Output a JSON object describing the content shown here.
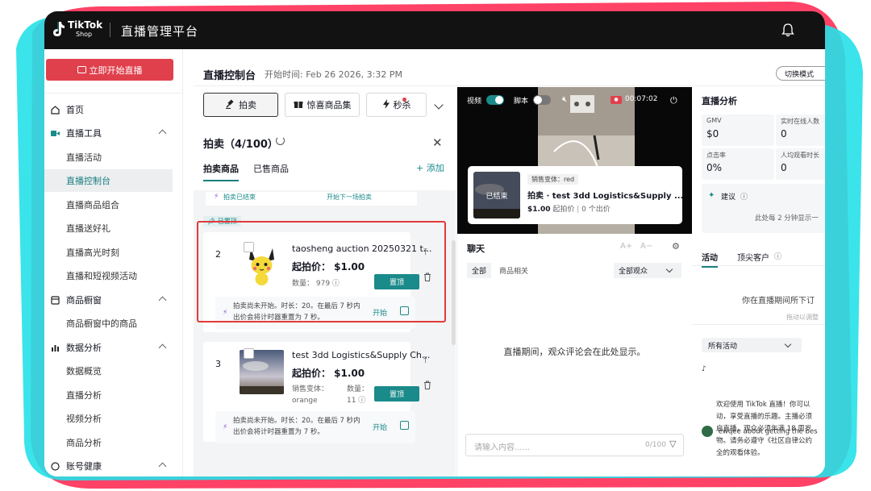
{
  "brand": {
    "logo_text": "TikTok",
    "logo_sub": "Shop",
    "platform_title": "直播管理平台",
    "accent": "#1a8a8a",
    "live_red": "#e0404c"
  },
  "sidebar": {
    "go_live": "立即开始直播",
    "items": [
      {
        "label": "首页",
        "icon": "home-icon",
        "level": 1
      },
      {
        "label": "直播工具",
        "icon": "video-icon",
        "level": 1
      },
      {
        "label": "直播活动",
        "level": 2
      },
      {
        "label": "直播控制台",
        "level": 2,
        "active": true
      },
      {
        "label": "直播商品组合",
        "level": 2
      },
      {
        "label": "直播送好礼",
        "level": 2
      },
      {
        "label": "直播高光时刻",
        "level": 2
      },
      {
        "label": "直播和短视频活动",
        "level": 2
      },
      {
        "label": "商品橱窗",
        "icon": "store-icon",
        "level": 1
      },
      {
        "label": "商品橱窗中的商品",
        "level": 2
      },
      {
        "label": "数据分析",
        "icon": "chart-icon",
        "level": 1
      },
      {
        "label": "数据概览",
        "level": 2
      },
      {
        "label": "直播分析",
        "level": 2
      },
      {
        "label": "视频分析",
        "level": 2
      },
      {
        "label": "商品分析",
        "level": 2
      },
      {
        "label": "账号健康",
        "icon": "health-icon",
        "level": 1
      }
    ]
  },
  "header": {
    "title": "直播控制台",
    "start_time": "开始时间: Feb 26 2026, 3:32 PM",
    "switch_mode": "切换模式"
  },
  "tools": {
    "auction": "拍卖",
    "surprise": "惊喜商品集",
    "flash": "秒杀"
  },
  "auction": {
    "title": "拍卖（4/100）",
    "tab_products": "拍卖商品",
    "tab_sold": "已售商品",
    "add": "添加",
    "prev_ended": "拍卖已结束",
    "prev_next": "开始下一场拍卖",
    "pinned_label": "已置顶",
    "cards": [
      {
        "index": "2",
        "name": "taosheng auction 20250321 t...",
        "price": "起拍价： $1.00",
        "qty": "数量： 979",
        "pin_btn": "置顶",
        "info": "拍卖尚未开始。时长：20。在最后 7 秒内出价会将计时器重置为 7 秒。",
        "start": "开始"
      },
      {
        "index": "3",
        "name": "test 3dd Logistics&Supply Ch...",
        "price": "起拍价： $1.00",
        "variant_label": "销售变体：",
        "variant_value": "orange",
        "qty_label": "数量：",
        "qty_value": "11",
        "pin_btn": "置顶",
        "info": "拍卖尚未开始。时长：20。在最后 7 秒内出价会将计时器重置为 7 秒。",
        "start": "开始"
      }
    ]
  },
  "video": {
    "video_label": "视频",
    "script_label": "脚本",
    "time": "00:07:02",
    "popup": {
      "variant": "销售变体：red",
      "ended": "已结束",
      "name": "拍卖 · test 3dd Logistics&Supply ...",
      "price": "$1.00",
      "price_label": "起拍价",
      "bids": "0 个出价"
    }
  },
  "chat": {
    "title": "聊天",
    "filter_all": "全部",
    "filter_product": "商品相关",
    "audience": "全部观众",
    "empty": "直播期间，观众评论会在此处显示。",
    "placeholder": "请输入内容......",
    "counter": "0/100"
  },
  "analytics": {
    "title": "直播分析",
    "stats": [
      {
        "label": "GMV",
        "value": "$0"
      },
      {
        "label": "实时在线人数",
        "value": "0"
      },
      {
        "label": "点击率",
        "value": "0%"
      },
      {
        "label": "人均观看时长",
        "value": "0"
      }
    ],
    "suggest": "建议",
    "suggest_note": "此处每 2 分钟显示一",
    "tab_activity": "活动",
    "tab_top": "顶尖客户",
    "activity_empty": "你在直播期间所下订",
    "drag_note": "拖动以调整",
    "all_activity": "所有活动",
    "welcome": "欢迎使用 TikTok 直播！你可以\n动，享受直播的乐趣。主播必须\n启直播，观众必须年满 18 周岁\n物。请务必遵守《社区自律公约\n全的观看体验。",
    "feed_item": "ewqee about getting the bes"
  }
}
